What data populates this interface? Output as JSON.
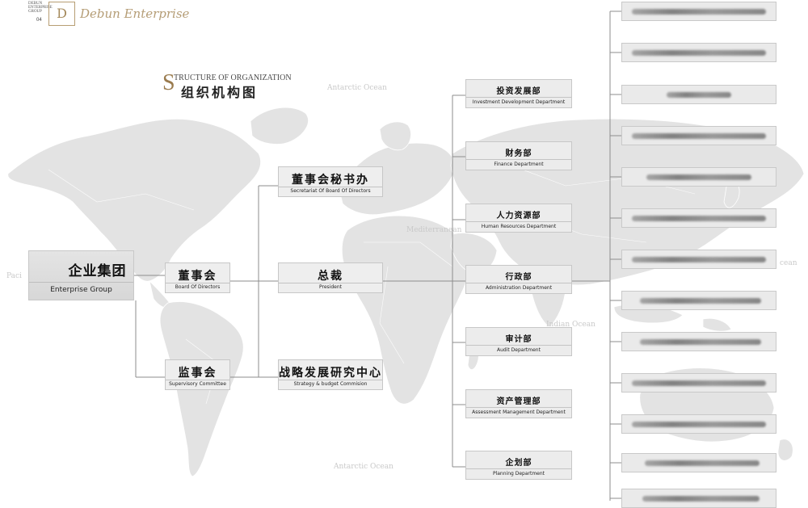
{
  "brand": {
    "small_lines": [
      "DEBUN",
      "ENTERPRISE",
      "GROUP"
    ],
    "page_number": "04",
    "logo_letter": "D",
    "script_name": "Debun Enterprise"
  },
  "title": {
    "en_cap": "S",
    "en_rest": "TRUCTURE OF ORGANIZATION",
    "cn": "组织机构图"
  },
  "oceans": {
    "top": "Antarctic Ocean",
    "med": "Mediterranean",
    "indian": "Indian Ocean",
    "bottom": "Antarctic Ocean",
    "pacific": "Paci",
    "right": "cean"
  },
  "root": {
    "cn": "企业集团",
    "en": "Enterprise Group"
  },
  "board": {
    "cn": "董事会",
    "en": "Board Of Directors"
  },
  "supervisory": {
    "cn": "监事会",
    "en": "Supervisory Committee"
  },
  "secretariat": {
    "cn": "董事会秘书办",
    "en": "Secretariat Of Board Of Directors"
  },
  "president": {
    "cn": "总裁",
    "en": "President"
  },
  "strategy": {
    "cn": "战略发展研究中心",
    "en": "Strategy & budget Commision"
  },
  "departments": [
    {
      "cn": "投资发展部",
      "en": "Investment Development Department"
    },
    {
      "cn": "财务部",
      "en": "Finance Department"
    },
    {
      "cn": "人力资源部",
      "en": "Human Resources Department"
    },
    {
      "cn": "行政部",
      "en": "Administration Department"
    },
    {
      "cn": "审计部",
      "en": "Audit Department"
    },
    {
      "cn": "资产管理部",
      "en": "Assessment Management Department"
    },
    {
      "cn": "企划部",
      "en": "Planning Department"
    }
  ],
  "companies_blurred_count": 13,
  "colors": {
    "accent_gold": "#9a7b4e",
    "box_fill": "#eeeeee",
    "line": "#999999",
    "map": "#e2e2e2"
  }
}
